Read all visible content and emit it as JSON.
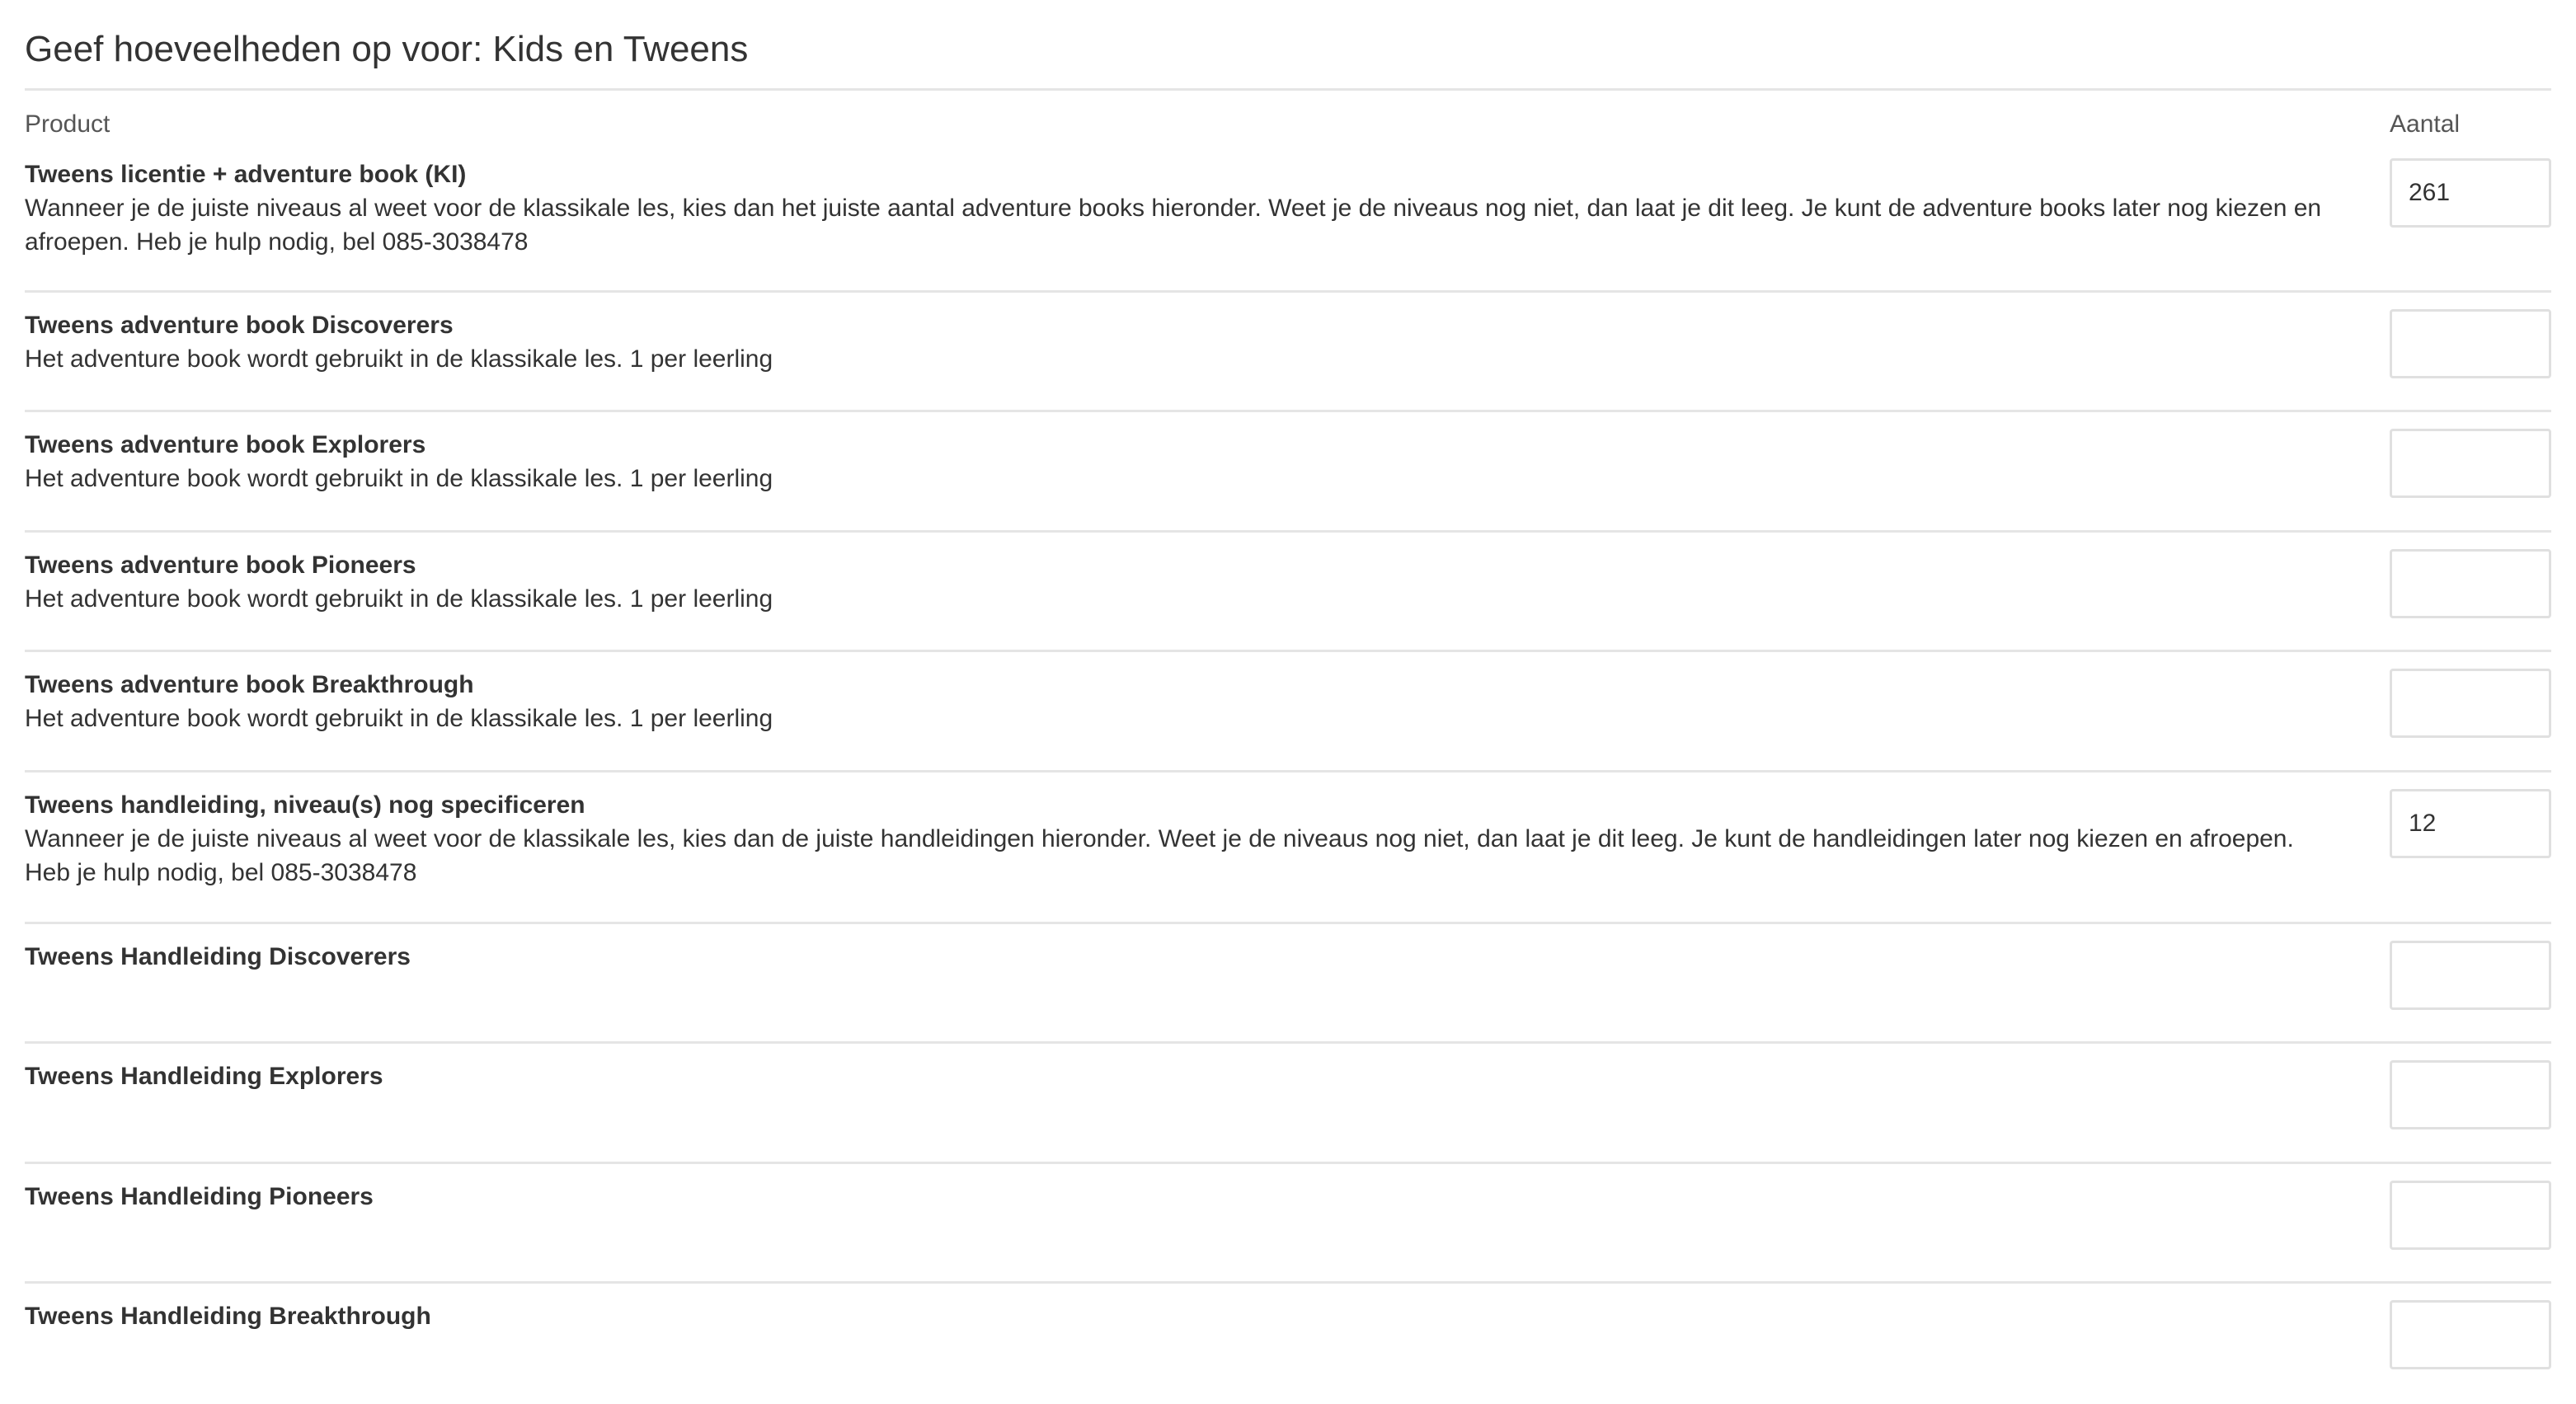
{
  "page": {
    "title": "Geef hoeveelheden op voor: Kids en Tweens"
  },
  "table": {
    "col_product": "Product",
    "col_quantity": "Aantal",
    "rows": [
      {
        "name": "Tweens licentie + adventure book (KI)",
        "description": "Wanneer je de juiste niveaus al weet voor de klassikale les, kies dan het juiste aantal adventure books hieronder. Weet je de niveaus nog niet, dan laat je dit leeg. Je kunt de adventure books later nog kiezen en afroepen. Heb je hulp nodig, bel 085-3038478",
        "quantity": "261"
      },
      {
        "name": "Tweens adventure book Discoverers",
        "description": "Het adventure book wordt gebruikt in de klassikale les. 1 per leerling",
        "quantity": ""
      },
      {
        "name": "Tweens adventure book Explorers",
        "description": "Het adventure book wordt gebruikt in de klassikale les. 1 per leerling",
        "quantity": ""
      },
      {
        "name": "Tweens adventure book Pioneers",
        "description": "Het adventure book wordt gebruikt in de klassikale les. 1 per leerling",
        "quantity": ""
      },
      {
        "name": "Tweens adventure book Breakthrough",
        "description": "Het adventure book wordt gebruikt in de klassikale les. 1 per leerling",
        "quantity": ""
      },
      {
        "name": "Tweens handleiding, niveau(s) nog specificeren",
        "description": "Wanneer je de juiste niveaus al weet voor de klassikale les, kies dan de juiste handleidingen hieronder. Weet je de niveaus nog niet, dan laat je dit leeg. Je kunt de handleidingen later nog kiezen en afroepen. Heb je hulp nodig, bel 085-3038478",
        "quantity": "12"
      },
      {
        "name": "Tweens Handleiding Discoverers",
        "description": "",
        "quantity": ""
      },
      {
        "name": "Tweens Handleiding Explorers",
        "description": "",
        "quantity": ""
      },
      {
        "name": "Tweens Handleiding Pioneers",
        "description": "",
        "quantity": ""
      },
      {
        "name": "Tweens Handleiding Breakthrough",
        "description": "",
        "quantity": ""
      }
    ]
  },
  "colors": {
    "text": "#333333",
    "divider": "#e5e5e5",
    "input_border": "#e0e0e0"
  }
}
